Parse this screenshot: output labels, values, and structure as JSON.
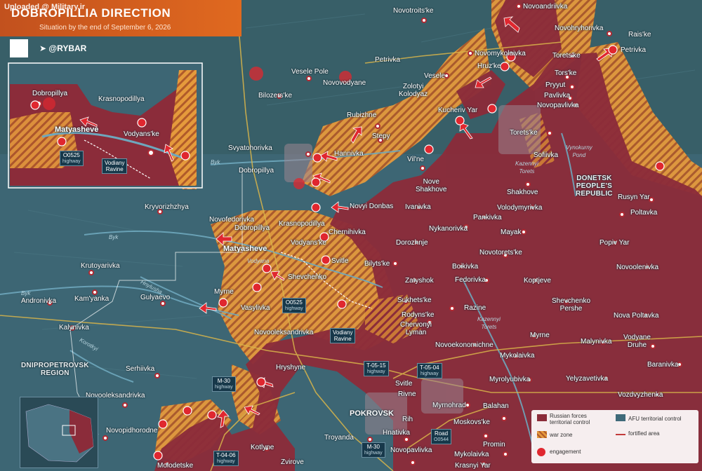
{
  "header": {
    "watermark": "Uploaded @ Military.ir",
    "title": "DOBROPILLIA DIRECTION",
    "subtitle": "Situation by the end of September 6, 2026",
    "brand": "@RYBAR"
  },
  "colors": {
    "water_background": "#2e4f5c",
    "land": "#3b6472",
    "russian_control": "#8b2c3a",
    "war_zone": "#e59a3c",
    "afu_control": "#3f6a79",
    "engagement": "#e0272f",
    "title_bg": "#d85d1f"
  },
  "regions": {
    "donetsk": "DONETSK\nPEOPLE'S\nREPUBLIC",
    "dnipropetrovsk": "DNIPROPETROVSK\nREGION"
  },
  "settlements": {
    "novoandriivka": "Novoandriivka",
    "novotroitske": "Novotroits'ke",
    "novohryhorivka": "Novohryhorivka",
    "raiske": "Rais'ke",
    "petrivka_n": "Petrivka",
    "petrivka_e": "Petrivka",
    "novomykolaivka": "Novomykolaivka",
    "torets_ke_n": "Torets'ke",
    "vesele_pole": "Vesele Pole",
    "novovodyane": "Novovodyane",
    "vesele": "Vesele",
    "hruzke": "Hruz'ke",
    "tors_ke": "Tors'ke",
    "bilozerske": "Bilozers'ke",
    "zolotyi_kolodyaz": "Zolotyi\nKolodyaz",
    "pryyut": "Pryyut",
    "pavlivka": "Pavlivka",
    "rubizhne": "Rubizhne",
    "kucheriv_yar": "Kucheriv Yar",
    "novopavlivka_n": "Novopavlivka",
    "stepy": "Stepy",
    "svyatohorivka": "Svyatohorivka",
    "toretske": "Torets'ke",
    "hannivka": "Hannivka",
    "sofiivka": "Sofiivka",
    "dobropillya": "Dobropillya",
    "vilne": "Vil'ne",
    "nove_shakhove": "Nove\nShakhove",
    "shakhove": "Shakhove",
    "rusyn_yar": "Rusyn Yar",
    "poltavka": "Poltavka",
    "kryvorizhzhya": "Kryvorizhzhya",
    "novyi_donbas": "Novyi Donbas",
    "ivanivka": "Ivanivka",
    "volodymyrivka": "Volodymyrivka",
    "novofedorivka": "Novofedorivka",
    "pankivka": "Pankivka",
    "dobropillya_m": "Dobropillya",
    "krasnopodillya": "Krasnopodillya",
    "chernihivka": "Chernihivka",
    "nykanorivka": "Nykanorivka",
    "mayak": "Mayak",
    "vodyanske": "Vodyans'ke",
    "dorozhnje": "Dorozhnje",
    "popiv_yar": "Popiv Yar",
    "matyasheve": "Matyasheve",
    "svitle_n": "Svitle",
    "bilytske": "Bilyts'ke",
    "novotoretske": "Novotorets'ke",
    "krutoyarivka": "Krutoyarivka",
    "boikivka": "Boikivka",
    "novoolenivka_e": "Novoolenivka",
    "shevchenko_m": "Shevchenko",
    "zatyshok": "Zatyshok",
    "fedorivka": "Fedorivka",
    "koptjeve": "Koptjeve",
    "andronivka": "Andronivka",
    "kamyanka": "Kam'yanka",
    "gulyaevo": "Gulyaevo",
    "myrne_w": "Myrne",
    "sukhetske": "Sukhets'ke",
    "shevchenko_pershe": "Shevchenko\nPershe",
    "vasylivka": "Vasylivka",
    "rodynske": "Rodyns'ke",
    "razine": "Razine",
    "nova_poltavka": "Nova Poltavka",
    "chervonyi_lyman": "Chervonyi\nLyman",
    "kalynivka": "Kalynivka",
    "novooleksandrivka_m": "Novooleksandrivka",
    "myrne_e": "Myrne",
    "malynivka": "Malynivka",
    "vodyane_druhe": "Vodyane\nDruhe",
    "novoekonomichne": "Novoekonomichne",
    "serhiivka": "Serhiivka",
    "hryshyne": "Hryshyne",
    "mykolaivka_e": "Mykolaivka",
    "baranivka": "Baranivka",
    "svitle_s": "Svitle",
    "myrolyubivka": "Myrolyubivka",
    "yelyzavetivka": "Yelyzavetivka",
    "novooleksandrivka_w": "Novooleksandrivka",
    "rivne": "Rivne",
    "myrnohrad": "Myrnohrad",
    "balahan": "Balahan",
    "vozdvyzhenka": "Vozdvyzhenka",
    "pokrovsk": "POKROVSK",
    "rih": "Rih",
    "moskovske": "Moskovs'ke",
    "novopidhorodne": "Novopidhorodne",
    "troyanda": "Troyanda",
    "hnativka": "Hnativka",
    "kotlyne": "Kotlyne",
    "novopavlivka_s": "Novopavlivka",
    "promin": "Promin",
    "molodetske": "Molodetske",
    "zvirove": "Zvirove",
    "mykolaivka_s": "Mykolaivka",
    "krasnyi_yar": "Krasnyi Yar"
  },
  "rivers": {
    "byk_n": "Byk",
    "byk_w": "Byk",
    "byk_far": "Byk",
    "vodyana": "Vodyana",
    "hnylusha": "Hnylusha",
    "kazennyi_torets_n": "Kazennyi\nTorets",
    "kazennyi_torets_s": "Kazennyi\nTorets",
    "vynokurny_pond": "Vynokurny\nPond",
    "korotkyi": "Korotkyi"
  },
  "highways": [
    {
      "id": "o0525",
      "code": "O0525",
      "kind": "highway"
    },
    {
      "id": "t0515",
      "code": "T-05-15",
      "kind": "highway"
    },
    {
      "id": "t0504",
      "code": "T-05-04",
      "kind": "highway"
    },
    {
      "id": "m30_w",
      "code": "M-30",
      "kind": "highway"
    },
    {
      "id": "m30_s",
      "code": "M-30",
      "kind": "highway"
    },
    {
      "id": "road_o0544",
      "code": "Road",
      "kind": "O0544"
    },
    {
      "id": "t0406",
      "code": "T-04-06",
      "kind": "highway"
    }
  ],
  "ravine": "Vodiany\nRavine",
  "inset": {
    "dobropillya": "Dobropillya",
    "krasnopodillya": "Krasnopodillya",
    "matyasheve": "Matyasheve",
    "vodyanske": "Vodyans'ke",
    "highway_code": "O0525",
    "highway_kind": "highway",
    "ravine": "Vodiany\nRavine"
  },
  "legend": {
    "russian": "Russian forces\nterritorial control",
    "afu": "AFU territorial control",
    "war_zone": "war zone",
    "fortified": "fortified area",
    "engagement": "engagement"
  }
}
